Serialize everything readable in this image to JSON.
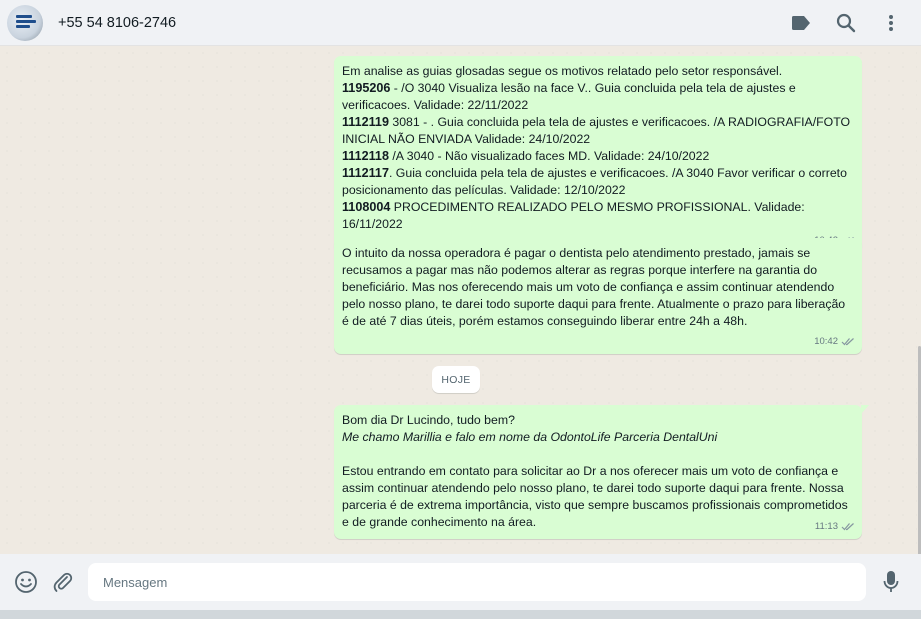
{
  "header": {
    "contact_name": "+55 54 8106-2746",
    "icons": [
      "tag-icon",
      "search-icon",
      "more-vert-icon"
    ]
  },
  "messages": [
    {
      "lines": [
        {
          "bold": "",
          "text": "Em analise as guias glosadas segue os motivos relatado pelo setor responsável."
        },
        {
          "bold": "1195206",
          "text": " - /O 3040 Visualiza lesão na face V.. Guia concluida pela tela de ajustes e verificacoes. Validade: 22/11/2022"
        },
        {
          "bold": "1112119",
          "text": " 3081 - . Guia concluida pela tela de ajustes e verificacoes. /A RADIOGRAFIA/FOTO INICIAL NÃO ENVIADA Validade: 24/10/2022"
        },
        {
          "bold": "1112118",
          "text": " /A 3040 - Não visualizado faces MD. Validade: 24/10/2022"
        },
        {
          "bold": "1112117",
          "text": ". Guia concluida pela tela de ajustes e verificacoes. /A 3040 Favor verificar o correto posicionamento das películas. Validade: 12/10/2022"
        },
        {
          "bold": "1108004",
          "text": " PROCEDIMENTO REALIZADO PELO MESMO PROFISSIONAL. Validade: 16/11/2022"
        }
      ],
      "time": "10:42",
      "status": "read"
    },
    {
      "text": "O intuito da nossa operadora é pagar o dentista pelo atendimento prestado, jamais se recusamos a pagar mas não podemos alterar as regras porque interfere na garantia do beneficiário. Mas nos oferecendo mais um voto de confiança e assim continuar atendendo pelo nosso plano, te darei todo suporte daqui para frente. Atualmente o prazo para liberação é de até 7 dias úteis, porém estamos conseguindo liberar entre 24h a 48h.",
      "time": "10:42",
      "status": "read"
    },
    {
      "greeting": "Bom dia Dr Lucindo, tudo bem?",
      "intro": "Me chamo Marillia e falo em nome da OdontoLife Parceria DentalUni",
      "body": "Estou entrando em contato para solicitar ao Dr a nos oferecer mais um voto de confiança e assim continuar atendendo pelo nosso plano, te darei todo suporte daqui para frente. Nossa parceria é de extrema importância, visto que sempre buscamos profissionais comprometidos e de grande conhecimento na área.",
      "time": "11:13",
      "status": "read"
    }
  ],
  "date_chip": "HOJE",
  "composer": {
    "placeholder": "Mensagem",
    "icons": [
      "emoji-icon",
      "attach-icon",
      "mic-icon"
    ]
  },
  "colors": {
    "outgoing_bubble": "#d9fdd3",
    "chat_background": "#efeae2",
    "header_background": "#f0f2f5",
    "icon_color": "#54656f"
  }
}
